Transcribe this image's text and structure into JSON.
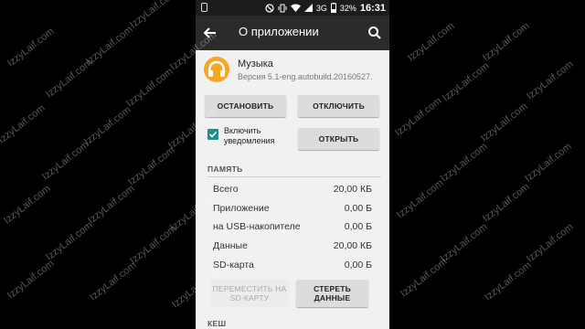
{
  "watermark": "IzzyLaif.com",
  "status_bar": {
    "network": "3G",
    "battery": "32%",
    "time": "16:31"
  },
  "app_bar": {
    "title": "О приложении"
  },
  "app": {
    "name": "Музыка",
    "version": "Версия 5.1-eng.autobuild.20160527."
  },
  "buttons": {
    "stop": "ОСТАНОВИТЬ",
    "disable": "ОТКЛЮЧИТЬ",
    "open": "ОТКРЫТЬ",
    "move_to_sd": "ПЕРЕМЕСТИТЬ НА SD-КАРТУ",
    "clear_data": "СТЕРЕТЬ ДАННЫЕ"
  },
  "notifications": {
    "label": "Включить уведомления",
    "checked": true
  },
  "memory": {
    "title": "ПАМЯТЬ",
    "rows": [
      {
        "label": "Всего",
        "value": "20,00 КБ"
      },
      {
        "label": "Приложение",
        "value": "0,00 Б"
      },
      {
        "label": "на USB-накопителе",
        "value": "0,00 Б"
      },
      {
        "label": "Данные",
        "value": "20,00 КБ"
      },
      {
        "label": "SD-карта",
        "value": "0,00 Б"
      }
    ]
  },
  "cache": {
    "title": "КЕШ"
  },
  "colors": {
    "accent": "#1d8f84",
    "app_icon": "#f5a623",
    "appbar": "#2b2b2b"
  }
}
